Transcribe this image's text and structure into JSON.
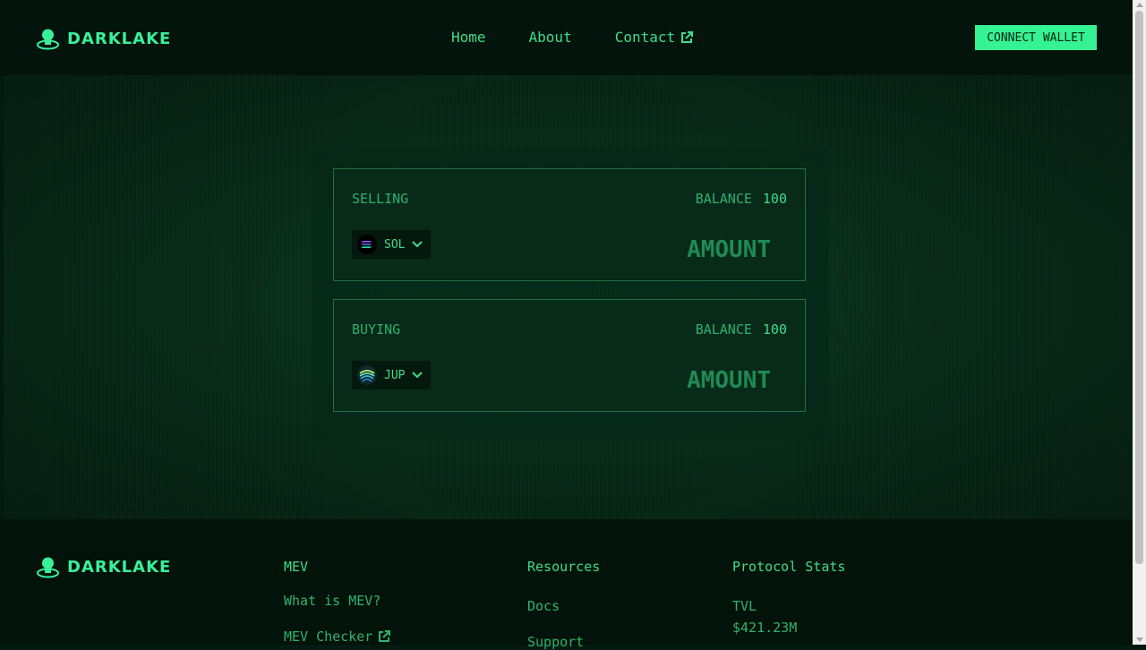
{
  "brand": {
    "name": "DARKLAKE"
  },
  "nav": {
    "home": "Home",
    "about": "About",
    "contact": "Contact"
  },
  "connect_wallet": "CONNECT WALLET",
  "swap": {
    "selling": {
      "label": "SELLING",
      "balance_label": "BALANCE",
      "balance_value": "100",
      "token": "SOL",
      "amount_placeholder": "AMOUNT"
    },
    "buying": {
      "label": "BUYING",
      "balance_label": "BALANCE",
      "balance_value": "100",
      "token": "JUP",
      "amount_placeholder": "AMOUNT"
    }
  },
  "footer": {
    "brand": "DARKLAKE",
    "mev": {
      "heading": "MEV",
      "links": [
        "What is MEV?",
        "MEV Checker"
      ]
    },
    "resources": {
      "heading": "Resources",
      "links": [
        "Docs",
        "Support"
      ]
    },
    "stats": {
      "heading": "Protocol Stats",
      "tvl_label": "TVL",
      "tvl_value": "$421.23M"
    }
  },
  "colors": {
    "accent": "#35f293",
    "background": "#021a10",
    "header": "#03140c",
    "card_border": "#1f6e47"
  },
  "icons": {
    "logo": "darklake-logo-icon",
    "external": "external-link-icon",
    "chevron": "chevron-down-icon",
    "sol": "sol-token-icon",
    "jup": "jup-token-icon"
  }
}
